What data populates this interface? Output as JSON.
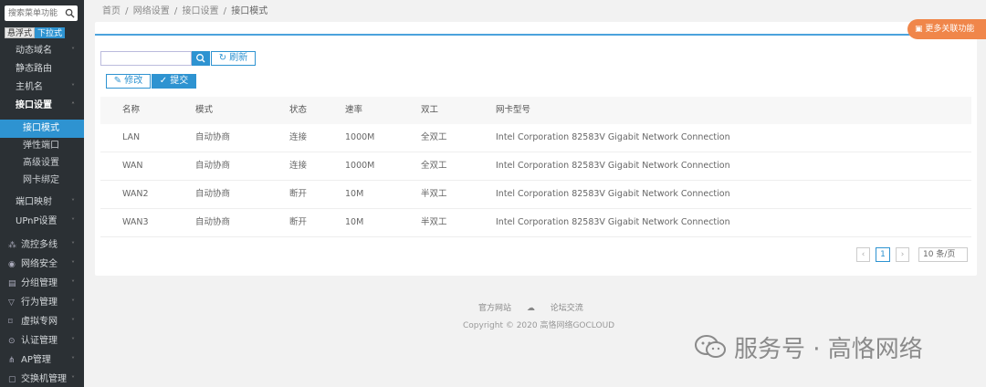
{
  "sidebar": {
    "search_placeholder": "搜索菜单功能",
    "mode_float": "悬浮式",
    "mode_dropdown": "下拉式",
    "items": [
      {
        "label": "动态域名"
      },
      {
        "label": "静态路由"
      },
      {
        "label": "主机名"
      },
      {
        "label": "接口设置"
      }
    ],
    "sub_items": [
      {
        "label": "接口模式"
      },
      {
        "label": "弹性端口"
      },
      {
        "label": "高级设置"
      },
      {
        "label": "网卡绑定"
      }
    ],
    "items_after": [
      {
        "label": "端口映射"
      },
      {
        "label": "UPnP设置"
      }
    ],
    "groups": [
      {
        "label": "流控多线",
        "icon": "group-icon"
      },
      {
        "label": "网络安全",
        "icon": "shield-icon"
      },
      {
        "label": "分组管理",
        "icon": "list-icon"
      },
      {
        "label": "行为管理",
        "icon": "filter-icon"
      },
      {
        "label": "虚拟专网",
        "icon": "vpn-icon"
      },
      {
        "label": "认证管理",
        "icon": "check-icon"
      },
      {
        "label": "AP管理",
        "icon": "ap-icon"
      },
      {
        "label": "交换机管理",
        "icon": "switch-icon"
      }
    ]
  },
  "breadcrumb": [
    "首页",
    "网络设置",
    "接口设置",
    "接口模式"
  ],
  "toolbar": {
    "refresh_label": "刷新",
    "edit_label": "修改",
    "submit_label": "提交"
  },
  "table": {
    "headers": [
      "名称",
      "模式",
      "状态",
      "速率",
      "双工",
      "网卡型号"
    ],
    "rows": [
      [
        "LAN",
        "自动协商",
        "连接",
        "1000M",
        "全双工",
        "Intel Corporation 82583V Gigabit Network Connection"
      ],
      [
        "WAN",
        "自动协商",
        "连接",
        "1000M",
        "全双工",
        "Intel Corporation 82583V Gigabit Network Connection"
      ],
      [
        "WAN2",
        "自动协商",
        "断开",
        "10M",
        "半双工",
        "Intel Corporation 82583V Gigabit Network Connection"
      ],
      [
        "WAN3",
        "自动协商",
        "断开",
        "10M",
        "半双工",
        "Intel Corporation 82583V Gigabit Network Connection"
      ]
    ]
  },
  "pagination": {
    "current_page": "1",
    "page_size": "10 条/页"
  },
  "float_button": "更多关联功能",
  "footer": {
    "link_official": "官方网站",
    "link_forum": "论坛交流",
    "copyright": "Copyright © 2020 高恪网络GOCLOUD"
  },
  "watermark": "服务号 · 高恪网络",
  "colors": {
    "accent": "#2e93d1",
    "sidebar_bg": "#2b3034",
    "float_button": "#f0864a"
  }
}
